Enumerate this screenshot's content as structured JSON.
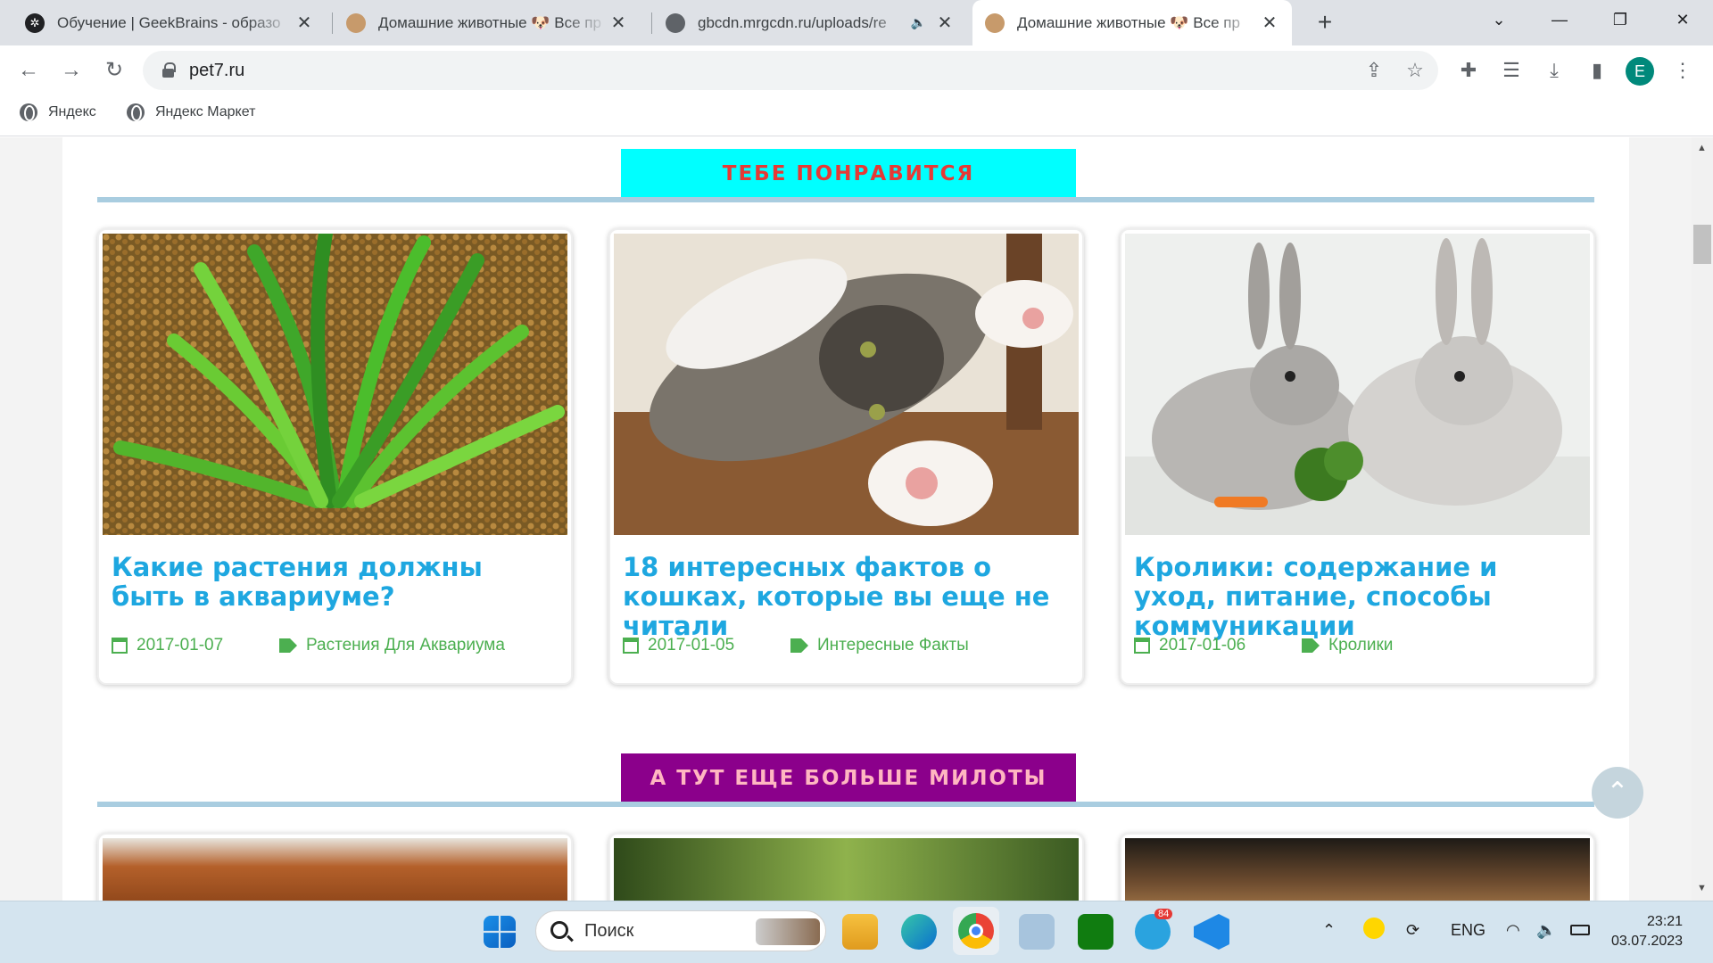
{
  "browser": {
    "tabs": [
      {
        "title": "Обучение | GeekBrains - образо",
        "active": false
      },
      {
        "title": "Домашние животные 🐶 Все пр",
        "active": false
      },
      {
        "title": "gbcdn.mrgcdn.ru/uploads/re",
        "active": false
      },
      {
        "title": "Домашние животные 🐶 Все пр",
        "active": true
      }
    ],
    "url": "pet7.ru",
    "profile_initial": "E",
    "bookmarks": [
      "Яндекс",
      "Яндекс Маркет"
    ]
  },
  "sections": [
    {
      "heading": "ТЕБЕ ПОНРАВИТСЯ",
      "heading_bg": "#00ffff",
      "heading_color": "#e53935",
      "cards": [
        {
          "title": "Какие растения должны быть в аквариуме?",
          "date": "2017-01-07",
          "tag": "Растения Для Аквариума"
        },
        {
          "title": "18 интересных фактов о кошках, которые вы еще не читали",
          "date": "2017-01-05",
          "tag": "Интересные Факты"
        },
        {
          "title": "Кролики: содержание и уход, питание, способы коммуникации",
          "date": "2017-01-06",
          "tag": "Кролики"
        }
      ]
    },
    {
      "heading": "А ТУТ ЕЩЕ БОЛЬШЕ МИЛОТЫ",
      "heading_bg": "#8b008b",
      "heading_color": "#ffb6c1"
    }
  ],
  "colors": {
    "title": "#1ea7e0",
    "meta": "#4caf50",
    "divider": "#a9cde0"
  },
  "taskbar": {
    "search_placeholder": "Поиск",
    "telegram_badge": "84",
    "language": "ENG",
    "time": "23:21",
    "date": "03.07.2023"
  }
}
